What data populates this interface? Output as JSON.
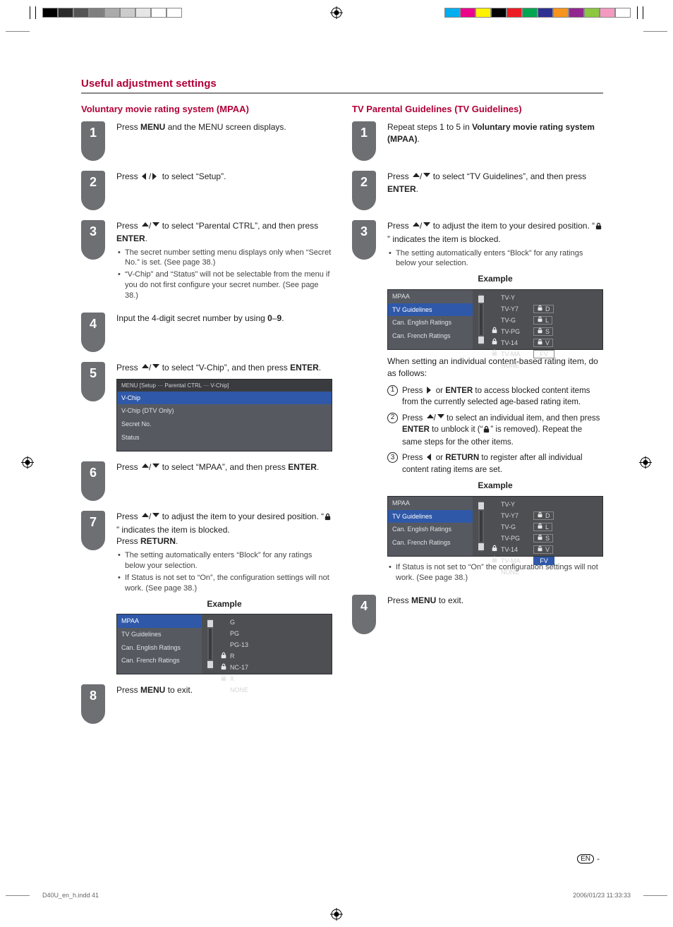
{
  "page": {
    "section_title": "Useful adjustment settings",
    "footer_file": "D40U_en_h.indd   41",
    "footer_date": "2006/01/23   11:33:33",
    "lang_badge": "EN",
    "example_label": "Example"
  },
  "left": {
    "heading": "Voluntary movie rating system (MPAA)",
    "steps": [
      {
        "n": "1",
        "text_pre": "Press ",
        "b1": "MENU",
        "text_post": " and the MENU screen displays."
      },
      {
        "n": "2",
        "text_pre": "Press ",
        "arrows": "lr",
        "text_post": " to select “Setup”."
      },
      {
        "n": "3",
        "text_pre": "Press ",
        "arrows": "ud",
        "mid": " to select “Parental CTRL”, and then press ",
        "b1": "ENTER",
        "post": ".",
        "bullets": [
          "The secret number setting menu displays only when “Secret No.” is set. (See page 38.)",
          "“V-Chip” and “Status” will not be selectable from the menu if you do not first configure your secret number. (See page 38.)"
        ]
      },
      {
        "n": "4",
        "text_pre": "Input the 4-digit secret number by using ",
        "b1": "0",
        "mid": "–",
        "b2": "9",
        "post": "."
      },
      {
        "n": "5",
        "text_pre": "Press ",
        "arrows": "ud",
        "mid": " to select “V-Chip”, and then press  ",
        "b1": "ENTER",
        "post": "."
      },
      {
        "n": "6",
        "text_pre": "Press ",
        "arrows": "ud",
        "mid": " to select “MPAA”, and then press  ",
        "b1": "ENTER",
        "post": "."
      },
      {
        "n": "7",
        "text_pre": "Press ",
        "arrows": "ud",
        "mid": " to adjust the item to your desired position. “",
        "lock": true,
        "mid2": "” indicates the item is blocked.",
        "newline": "Press ",
        "b1": "RETURN",
        "post": ".",
        "bullets": [
          "The setting automatically enters “Block” for any ratings below your selection.",
          "If Status is not set to “On”, the configuration settings will not work. (See page 38.)"
        ]
      },
      {
        "n": "8",
        "text_pre": "Press ",
        "b1": "MENU",
        "text_post": " to exit."
      }
    ],
    "osd5": {
      "crumb": "MENU    [Setup ··· Parental CTRL ··· V-Chip]",
      "items": [
        "V-Chip",
        "V-Chip (DTV Only)",
        "Secret No.",
        "Status"
      ]
    },
    "osd7": {
      "sidebar": [
        "MPAA",
        "TV Guidelines",
        "Can. English Ratings",
        "Can. French Ratings"
      ],
      "selected": 0,
      "ratings": [
        {
          "label": "G",
          "lock": false
        },
        {
          "label": "PG",
          "lock": false
        },
        {
          "label": "PG-13",
          "lock": false
        },
        {
          "label": "R",
          "lock": true
        },
        {
          "label": "NC-17",
          "lock": true
        },
        {
          "label": "X",
          "lock": true
        },
        {
          "label": "NONE",
          "lock": false
        }
      ]
    }
  },
  "right": {
    "heading": "TV Parental Guidelines (TV Guidelines)",
    "steps": [
      {
        "n": "1",
        "text_pre": "Repeat steps 1 to 5 in ",
        "b1": "Voluntary movie rating system (MPAA)",
        "post": "."
      },
      {
        "n": "2",
        "text_pre": "Press  ",
        "arrows": "ud",
        "mid": " to select “TV Guidelines”, and then press ",
        "b1": "ENTER",
        "post": "."
      },
      {
        "n": "3",
        "text_pre": "Press ",
        "arrows": "ud",
        "mid": " to adjust the item to your desired position. “",
        "lock": true,
        "mid2": "” indicates the item is blocked.",
        "bullets": [
          "The setting automatically enters “Block” for any ratings below your selection."
        ]
      },
      {
        "n": "4",
        "text_pre": "Press ",
        "b1": "MENU",
        "text_post": " to exit."
      }
    ],
    "between_text": "When setting an individual content-based rating item, do as follows:",
    "sub_steps": [
      {
        "n": "1",
        "pre": "Press ",
        "arrow": "r",
        "mid": " or ",
        "b": "ENTER",
        "post": " to access blocked content items from the currently selected age-based rating item."
      },
      {
        "n": "2",
        "pre": "Press ",
        "arrows": "ud",
        "mid": " to select an individual item, and then press ",
        "b": "ENTER",
        "mid2": " to unblock it (“",
        "lock": true,
        "mid3": "” is removed). Repeat the same steps for the other items."
      },
      {
        "n": "3",
        "pre": "Press ",
        "arrow": "l",
        "mid": " or ",
        "b": "RETURN",
        "post": " to register after all individual content rating items are set."
      }
    ],
    "post_bullet": "If Status is not set to “On” the configuration settings will not work. (See page 38.)",
    "osd3": {
      "sidebar": [
        "MPAA",
        "TV Guidelines",
        "Can. English Ratings",
        "Can. French Ratings"
      ],
      "selected": 1,
      "rows": [
        {
          "label": "TV-Y",
          "lock": false,
          "box": null
        },
        {
          "label": "TV-Y7",
          "lock": false,
          "box": {
            "lock": true,
            "t": "D"
          }
        },
        {
          "label": "TV-G",
          "lock": false,
          "box": {
            "lock": true,
            "t": "L"
          }
        },
        {
          "label": "TV-PG",
          "lock": true,
          "box": {
            "lock": true,
            "t": "S"
          }
        },
        {
          "label": "TV-14",
          "lock": true,
          "box": {
            "lock": true,
            "t": "V"
          }
        },
        {
          "label": "TV-MA",
          "lock": true,
          "box": {
            "lock": false,
            "t": "FV",
            "wide": true
          }
        },
        {
          "label": "NONE",
          "lock": false,
          "box": null
        }
      ]
    },
    "osd_sub": {
      "sidebar": [
        "MPAA",
        "TV Guidelines",
        "Can. English Ratings",
        "Can. French Ratings"
      ],
      "selected": 1,
      "rows": [
        {
          "label": "TV-Y",
          "lock": false,
          "box": null
        },
        {
          "label": "TV-Y7",
          "lock": false,
          "box": {
            "lock": true,
            "t": "D"
          }
        },
        {
          "label": "TV-G",
          "lock": false,
          "box": {
            "lock": true,
            "t": "L"
          }
        },
        {
          "label": "TV-PG",
          "lock": false,
          "box": {
            "lock": true,
            "t": "S"
          }
        },
        {
          "label": "TV-14",
          "lock": true,
          "box": {
            "lock": true,
            "t": "V"
          }
        },
        {
          "label": "TV-MA",
          "lock": true,
          "box": {
            "lock": false,
            "t": "FV",
            "wide": true,
            "hl": true
          }
        },
        {
          "label": "NONE",
          "lock": false,
          "box": null
        }
      ]
    }
  },
  "swatch_colors_left": [
    "#000",
    "#2b2b2b",
    "#555",
    "#7f7f7f",
    "#aaa",
    "#ccc",
    "#e6e6e6",
    "#fff",
    "#fff"
  ],
  "swatch_colors_right": [
    "#00aeef",
    "#ec008c",
    "#fff200",
    "#000",
    "#ed1c24",
    "#00a651",
    "#2e3192",
    "#f7941d",
    "#92278f",
    "#8dc63f",
    "#f49ac1",
    "#fff"
  ]
}
